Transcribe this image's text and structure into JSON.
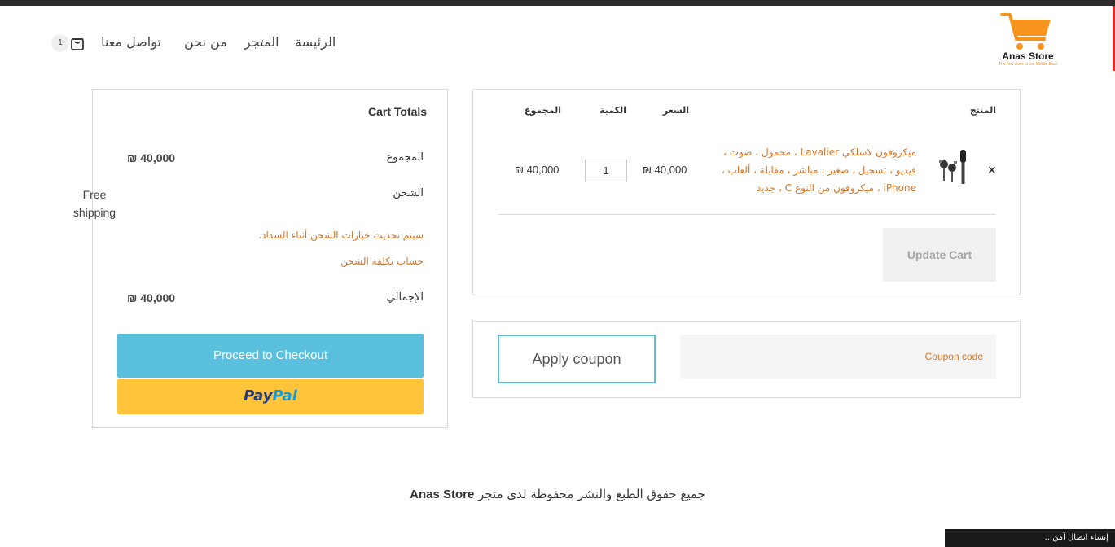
{
  "brand": {
    "name": "Anas Store",
    "tagline": "The first store in the Middle East",
    "accent_color": "#f7941d"
  },
  "nav": {
    "home": "الرئيسة",
    "shop": "المتجر",
    "about": "من نحن",
    "contact": "تواصل معنا",
    "cart_count": "1",
    "cart_icon": "shopping-bag-icon"
  },
  "cart_table": {
    "headers": {
      "product": "المنتج",
      "price": "السعر",
      "quantity": "الكمية",
      "subtotal": "المجموع"
    },
    "item": {
      "remove_icon": "close-icon",
      "name_part1": "ميكروفون لاسلكي",
      "name_en1": "Lavalier",
      "name_part2": "، محمول ، صوت ، فيديو ، تسجيل ، صغير ، مباشر ، مقابلة ، ألعاب ،",
      "name_en2": "iPhone",
      "name_part3": "، ميكروفون من النوع",
      "name_en3": "C",
      "name_part4": "، جديد",
      "price": "₪ 40,000",
      "quantity": "1",
      "subtotal": "₪ 40,000"
    },
    "update_button": "Update Cart"
  },
  "coupon": {
    "placeholder": "Coupon code",
    "apply_button": "Apply coupon"
  },
  "totals": {
    "title": "Cart Totals",
    "subtotal_label": "المجموع",
    "subtotal_value": "₪ 40,000",
    "shipping_label": "الشحن",
    "shipping_value": "Free shipping",
    "shipping_note": "سيتم تحديث خيارات الشحن أثناء السداد.",
    "shipping_calc": "حساب تكلفة الشحن",
    "total_label": "الإجمالي",
    "total_value": "₪ 40,000",
    "checkout_button": "Proceed to Checkout",
    "paypal_part1": "Pay",
    "paypal_part2": "Pal"
  },
  "footer": {
    "text": "جميع حقوق الطبع والنشر محفوظة لدى متجر",
    "brand": "Anas Store"
  },
  "status": {
    "toast": "إنشاء اتصال آمن..."
  }
}
